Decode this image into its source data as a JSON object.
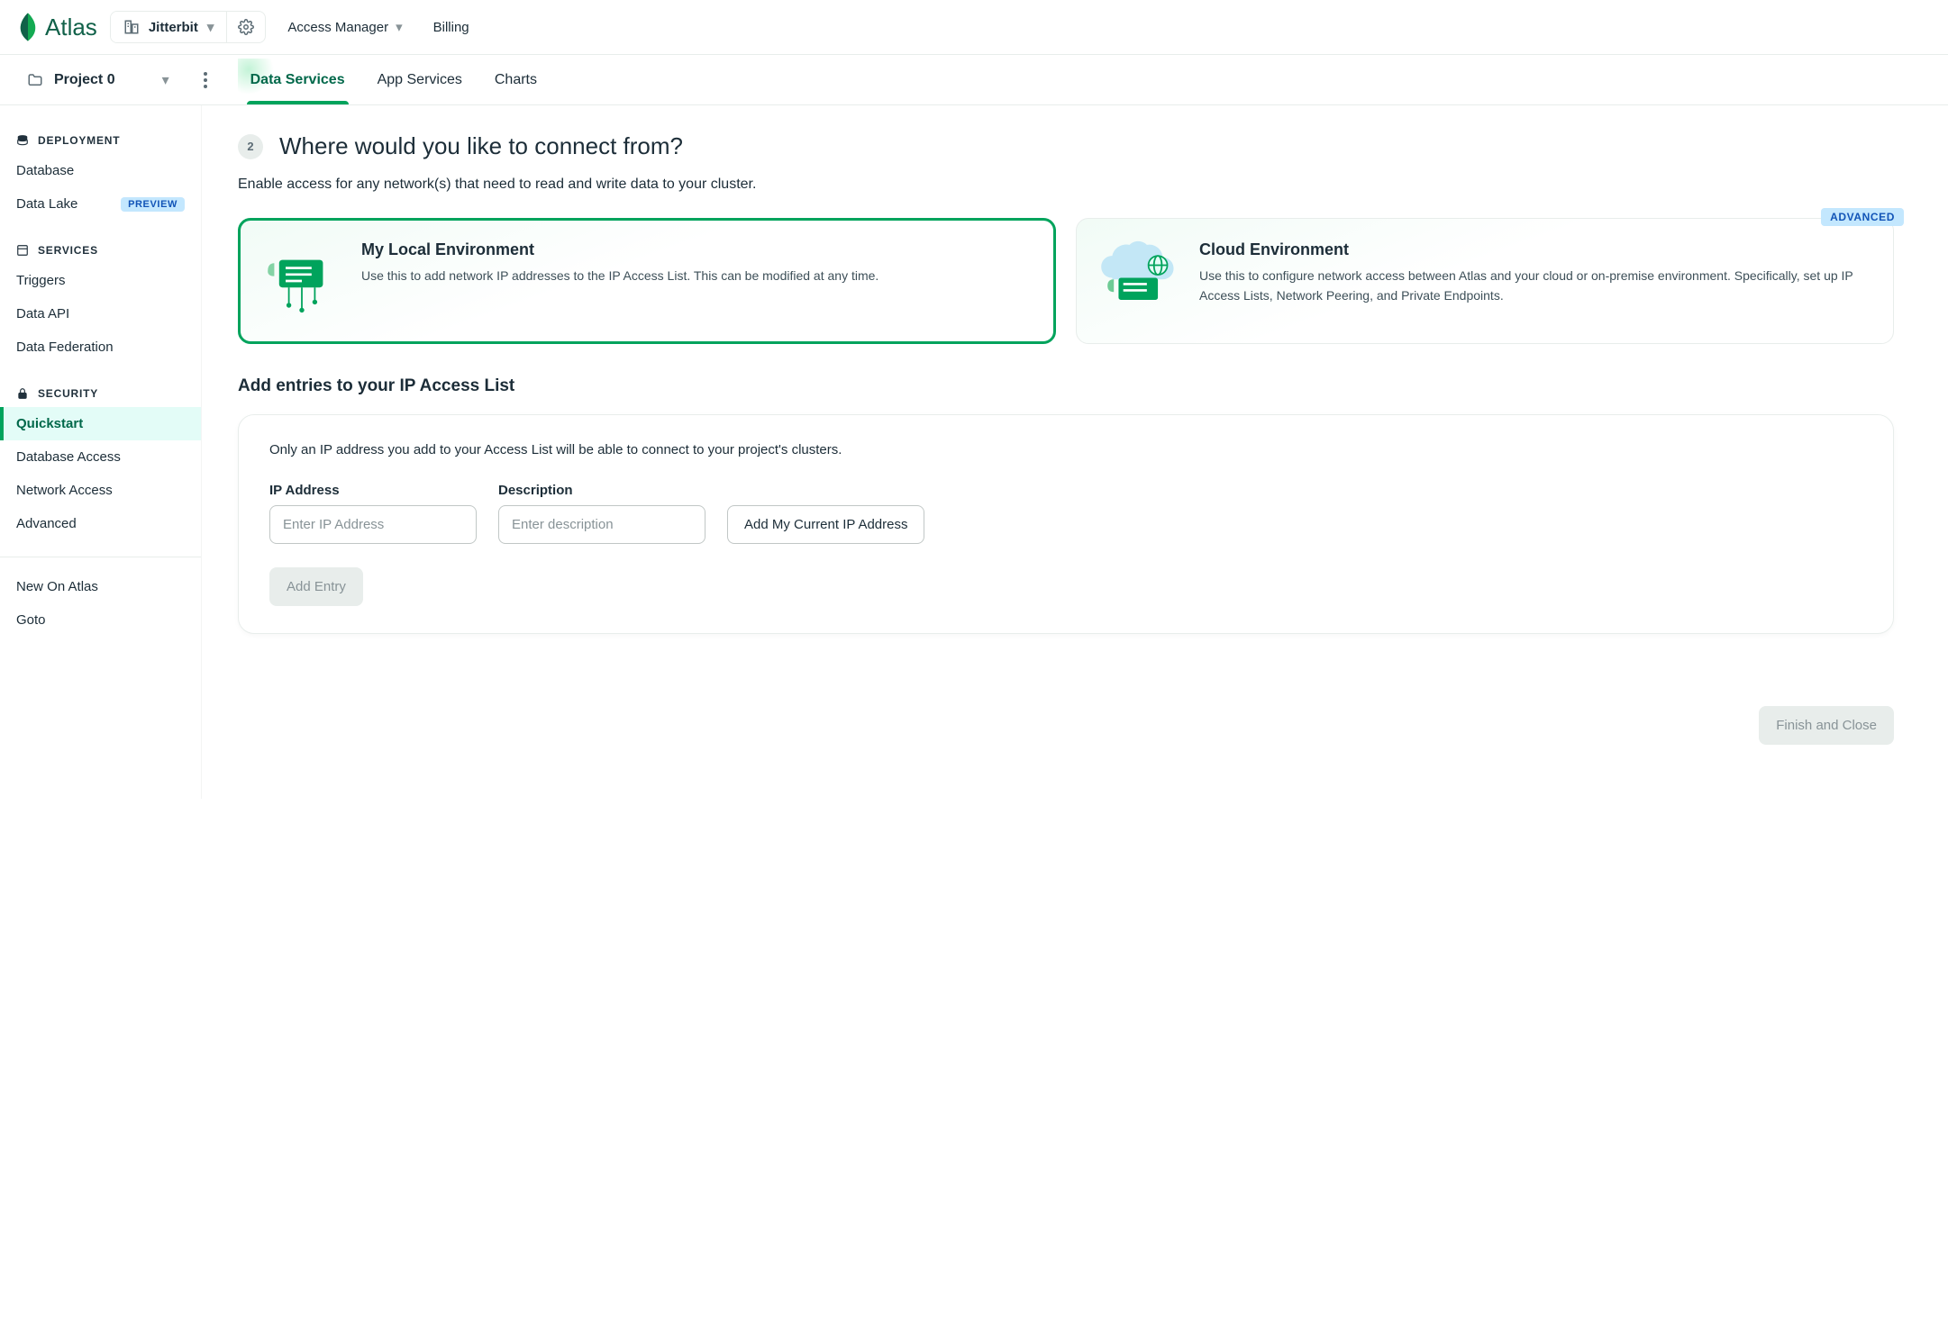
{
  "brand": "Atlas",
  "org": {
    "name": "Jitterbit"
  },
  "topnav": {
    "access_manager": "Access Manager",
    "billing": "Billing"
  },
  "project": {
    "name": "Project 0"
  },
  "tabs": {
    "data_services": "Data Services",
    "app_services": "App Services",
    "charts": "Charts"
  },
  "sidebar": {
    "deployment_heading": "DEPLOYMENT",
    "database": "Database",
    "data_lake": "Data Lake",
    "preview_badge": "PREVIEW",
    "services_heading": "SERVICES",
    "triggers": "Triggers",
    "data_api": "Data API",
    "data_federation": "Data Federation",
    "security_heading": "SECURITY",
    "quickstart": "Quickstart",
    "database_access": "Database Access",
    "network_access": "Network Access",
    "advanced": "Advanced",
    "new_on_atlas": "New On Atlas",
    "goto": "Goto"
  },
  "step": {
    "number": "2",
    "title": "Where would you like to connect from?",
    "subtitle": "Enable access for any network(s) that need to read and write data to your cluster."
  },
  "cards": {
    "local_title": "My Local Environment",
    "local_text": "Use this to add network IP addresses to the IP Access List. This can be modified at any time.",
    "cloud_title": "Cloud Environment",
    "cloud_text": "Use this to configure network access between Atlas and your cloud or on-premise environment. Specifically, set up IP Access Lists, Network Peering, and Private Endpoints.",
    "advanced_badge": "ADVANCED"
  },
  "section": {
    "title": "Add entries to your IP Access List",
    "info": "Only an IP address you add to your Access List will be able to connect to your project's clusters.",
    "ip_label": "IP Address",
    "ip_placeholder": "Enter IP Address",
    "desc_label": "Description",
    "desc_placeholder": "Enter description",
    "add_current_btn": "Add My Current IP Address",
    "add_entry_btn": "Add Entry"
  },
  "footer": {
    "finish": "Finish and Close"
  }
}
